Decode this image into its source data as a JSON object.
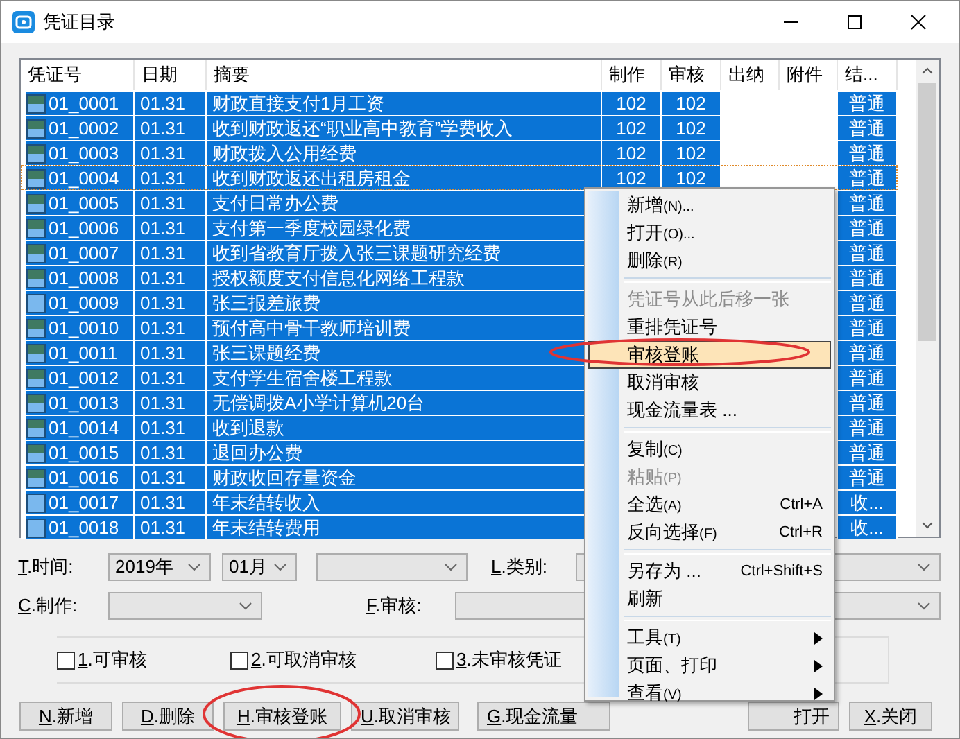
{
  "window": {
    "title": "凭证目录"
  },
  "table": {
    "columns": [
      "凭证号",
      "日期",
      "摘要",
      "制作",
      "审核",
      "出纳",
      "附件",
      "结..."
    ],
    "rows": [
      {
        "posted": true,
        "focused": false,
        "cells": [
          "01_0001",
          "01.31",
          "财政直接支付1月工资",
          "102",
          "102",
          null,
          null,
          "普通"
        ]
      },
      {
        "posted": true,
        "focused": false,
        "cells": [
          "01_0002",
          "01.31",
          "收到财政返还“职业高中教育”学费收入",
          "102",
          "102",
          null,
          null,
          "普通"
        ]
      },
      {
        "posted": true,
        "focused": false,
        "cells": [
          "01_0003",
          "01.31",
          "财政拨入公用经费",
          "102",
          "102",
          null,
          null,
          "普通"
        ]
      },
      {
        "posted": true,
        "focused": true,
        "cells": [
          "01_0004",
          "01.31",
          "收到财政返还出租房租金",
          "102",
          "102",
          null,
          null,
          "普通"
        ]
      },
      {
        "posted": true,
        "focused": false,
        "cells": [
          "01_0005",
          "01.31",
          "支付日常办公费",
          null,
          null,
          null,
          null,
          "普通"
        ]
      },
      {
        "posted": true,
        "focused": false,
        "cells": [
          "01_0006",
          "01.31",
          "支付第一季度校园绿化费",
          null,
          null,
          null,
          null,
          "普通"
        ]
      },
      {
        "posted": true,
        "focused": false,
        "cells": [
          "01_0007",
          "01.31",
          "收到省教育厅拨入张三课题研究经费",
          null,
          null,
          null,
          null,
          "普通"
        ]
      },
      {
        "posted": true,
        "focused": false,
        "cells": [
          "01_0008",
          "01.31",
          "授权额度支付信息化网络工程款",
          null,
          null,
          null,
          null,
          "普通"
        ]
      },
      {
        "posted": false,
        "focused": false,
        "cells": [
          "01_0009",
          "01.31",
          "张三报差旅费",
          null,
          null,
          null,
          null,
          "普通"
        ]
      },
      {
        "posted": true,
        "focused": false,
        "cells": [
          "01_0010",
          "01.31",
          "预付高中骨干教师培训费",
          null,
          null,
          null,
          null,
          "普通"
        ]
      },
      {
        "posted": true,
        "focused": false,
        "cells": [
          "01_0011",
          "01.31",
          "张三课题经费",
          null,
          null,
          null,
          null,
          "普通"
        ]
      },
      {
        "posted": true,
        "focused": false,
        "cells": [
          "01_0012",
          "01.31",
          "支付学生宿舍楼工程款",
          null,
          null,
          null,
          null,
          "普通"
        ]
      },
      {
        "posted": true,
        "focused": false,
        "cells": [
          "01_0013",
          "01.31",
          "无偿调拨A小学计算机20台",
          null,
          null,
          null,
          null,
          "普通"
        ]
      },
      {
        "posted": true,
        "focused": false,
        "cells": [
          "01_0014",
          "01.31",
          "收到退款",
          null,
          null,
          null,
          null,
          "普通"
        ]
      },
      {
        "posted": true,
        "focused": false,
        "cells": [
          "01_0015",
          "01.31",
          "退回办公费",
          null,
          null,
          null,
          null,
          "普通"
        ]
      },
      {
        "posted": true,
        "focused": false,
        "cells": [
          "01_0016",
          "01.31",
          "财政收回存量资金",
          null,
          null,
          null,
          null,
          "普通"
        ]
      },
      {
        "posted": false,
        "focused": false,
        "cells": [
          "01_0017",
          "01.31",
          "年末结转收入",
          null,
          null,
          null,
          null,
          "收..."
        ]
      },
      {
        "posted": false,
        "focused": false,
        "cells": [
          "01_0018",
          "01.31",
          "年末结转费用",
          null,
          null,
          null,
          null,
          "收..."
        ]
      }
    ]
  },
  "filters": {
    "time": {
      "key": "T",
      "label": ".时间:",
      "year": "2019年",
      "month": "01月"
    },
    "category": {
      "key": "L",
      "label": ".类别:"
    },
    "maker": {
      "key": "C",
      "label": ".制作:"
    },
    "reviewer": {
      "key": "F",
      "label": ".审核:"
    }
  },
  "options": [
    {
      "key": "1",
      "label": ".可审核",
      "checked": false
    },
    {
      "key": "2",
      "label": ".可取消审核",
      "checked": false
    },
    {
      "key": "3",
      "label": ".未审核凭证",
      "checked": false
    }
  ],
  "buttons": [
    {
      "key": "N",
      "label": ".新增"
    },
    {
      "key": "D",
      "label": ".删除"
    },
    {
      "key": "H",
      "label": ".审核登账"
    },
    {
      "key": "U",
      "label": ".取消审核"
    },
    {
      "key": "G",
      "label": ".现金流量"
    },
    {
      "label": "打开"
    },
    {
      "key": "X",
      "label": ".关闭"
    }
  ],
  "context_menu": [
    {
      "kind": "item",
      "label": "新增",
      "hint": "(N)...",
      "disabled": false,
      "selected": false,
      "submenu": false
    },
    {
      "kind": "item",
      "label": "打开",
      "hint": "(O)...",
      "disabled": false,
      "selected": false,
      "submenu": false
    },
    {
      "kind": "item",
      "label": "删除",
      "hint": "(R)",
      "disabled": false,
      "selected": false,
      "submenu": false
    },
    {
      "kind": "separator"
    },
    {
      "kind": "item",
      "label": "凭证号从此后移一张",
      "disabled": true,
      "selected": false,
      "submenu": false
    },
    {
      "kind": "item",
      "label": "重排凭证号",
      "disabled": false,
      "selected": false,
      "submenu": false
    },
    {
      "kind": "item",
      "label": "审核登账",
      "disabled": false,
      "selected": true,
      "submenu": false
    },
    {
      "kind": "item",
      "label": "取消审核",
      "disabled": false,
      "selected": false,
      "submenu": false
    },
    {
      "kind": "item",
      "label": "现金流量表 ...",
      "disabled": false,
      "selected": false,
      "submenu": false
    },
    {
      "kind": "separator"
    },
    {
      "kind": "item",
      "label": "复制",
      "hint": "(C)",
      "disabled": false,
      "selected": false,
      "submenu": false
    },
    {
      "kind": "item",
      "label": "粘贴",
      "hint": "(P)",
      "disabled": true,
      "selected": false,
      "submenu": false
    },
    {
      "kind": "item",
      "label": "全选",
      "hint": "(A)",
      "shortcut": "Ctrl+A",
      "disabled": false,
      "selected": false,
      "submenu": false
    },
    {
      "kind": "item",
      "label": "反向选择",
      "hint": "(F)",
      "shortcut": "Ctrl+R",
      "disabled": false,
      "selected": false,
      "submenu": false
    },
    {
      "kind": "separator"
    },
    {
      "kind": "item",
      "label": "另存为 ...",
      "shortcut": "Ctrl+Shift+S",
      "disabled": false,
      "selected": false,
      "submenu": false
    },
    {
      "kind": "item",
      "label": "刷新",
      "disabled": false,
      "selected": false,
      "submenu": false
    },
    {
      "kind": "separator"
    },
    {
      "kind": "item",
      "label": "工具",
      "hint": "(T)",
      "disabled": false,
      "selected": false,
      "submenu": true
    },
    {
      "kind": "item",
      "label": "页面、打印",
      "disabled": false,
      "selected": false,
      "submenu": true
    },
    {
      "kind": "item",
      "label": "查看",
      "hint": "(V)",
      "disabled": false,
      "selected": false,
      "submenu": true
    }
  ]
}
